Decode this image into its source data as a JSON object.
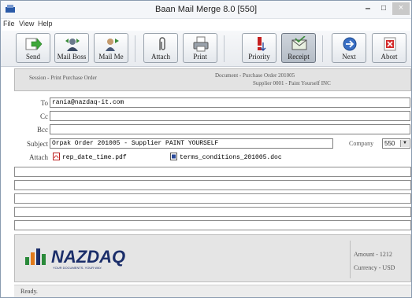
{
  "window": {
    "title": "Baan Mail Merge 8.0 [550]",
    "controls": {
      "minimize": "–",
      "maximize": "□",
      "close": "×"
    }
  },
  "menu": [
    "File",
    "View",
    "Help"
  ],
  "toolbar": {
    "buttons": [
      {
        "label": "Send",
        "icon": "send-icon"
      },
      {
        "label": "Mail Boss",
        "icon": "mail-boss-icon"
      },
      {
        "label": "Mail Me",
        "icon": "mail-me-icon"
      },
      {
        "label": "Attach",
        "icon": "paperclip-icon"
      },
      {
        "label": "Print",
        "icon": "printer-icon"
      },
      {
        "label": "Priority",
        "icon": "priority-icon"
      },
      {
        "label": "Receipt",
        "icon": "receipt-icon",
        "active": true
      },
      {
        "label": "Next",
        "icon": "next-arrow-icon"
      },
      {
        "label": "Abort",
        "icon": "abort-icon"
      }
    ]
  },
  "info": {
    "session": "Session - Print Purchase Order",
    "document": "Document - Purchase Order 201005",
    "supplier": "Supplier  0001  -  Paint Yourself INC"
  },
  "form": {
    "to_label": "To",
    "to_value": "rania@nazdaq-it.com",
    "cc_label": "Cc",
    "cc_value": "",
    "bcc_label": "Bcc",
    "bcc_value": "",
    "subject_label": "Subject",
    "subject_value": "Orpak Order 201005 - Supplier PAINT YOURSELF",
    "company_label": "Company",
    "company_value": "550",
    "attach_label": "Attach",
    "attachments": [
      {
        "name": "rep_date_time.pdf",
        "icon": "pdf-file-icon"
      },
      {
        "name": "terms_conditions_201005.doc",
        "icon": "doc-file-icon"
      }
    ]
  },
  "footer": {
    "logo_text": "NAZDAQ",
    "logo_tagline": "YOUR DOCUMENTS. YOUR WAY.",
    "amount": "Amount - 1212",
    "currency": "Currency - USD"
  },
  "status": "Ready."
}
